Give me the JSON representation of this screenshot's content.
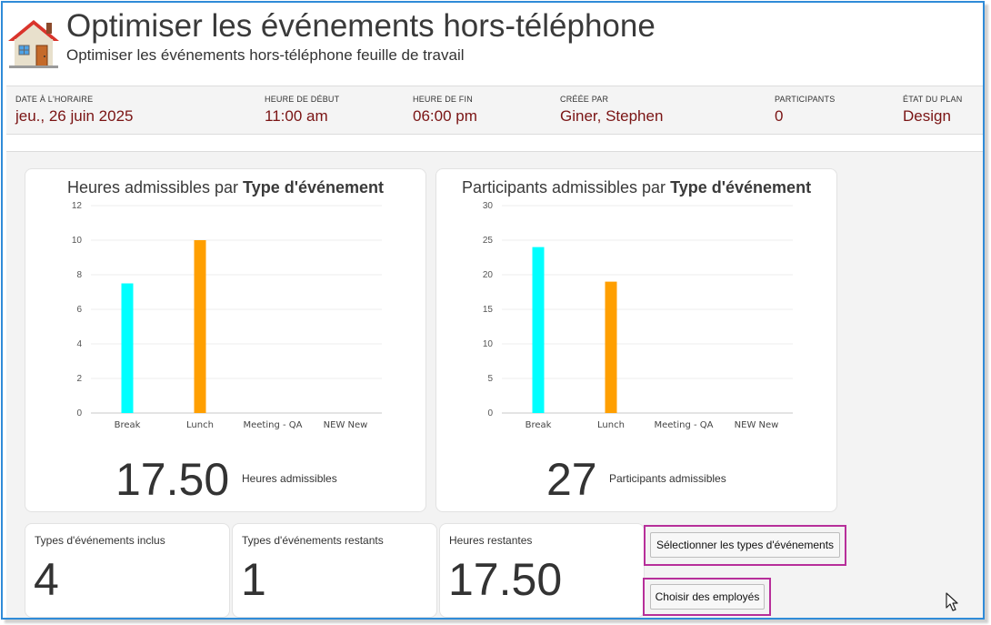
{
  "header": {
    "title": "Optimiser les événements hors-téléphone",
    "subtitle": "Optimiser les événements hors-téléphone feuille de travail",
    "icon": "house-icon"
  },
  "info": [
    {
      "label": "DATE À L'HORAIRE",
      "value": "jeu., 26 juin 2025"
    },
    {
      "label": "HEURE DE DÉBUT",
      "value": "11:00 am"
    },
    {
      "label": "HEURE DE FIN",
      "value": "06:00 pm"
    },
    {
      "label": "CRÉÉE PAR",
      "value": "Giner, Stephen"
    },
    {
      "label": "PARTICIPANTS",
      "value": "0"
    },
    {
      "label": "ÉTAT DU PLAN",
      "value": "Design"
    }
  ],
  "cards": {
    "hours": {
      "title_prefix": "Heures admissibles par",
      "title_bold": "Type d'événement",
      "total": "17.50",
      "total_label": "Heures admissibles"
    },
    "participants": {
      "title_prefix": "Participants admissibles par",
      "title_bold": "Type d'événement",
      "total": "27",
      "total_label": "Participants admissibles"
    }
  },
  "chart_data": [
    {
      "type": "bar",
      "title": "Heures admissibles par Type d'événement",
      "categories": [
        "Break",
        "Lunch",
        "Meeting - QA",
        "NEW New"
      ],
      "values": [
        7.5,
        10,
        0,
        0
      ],
      "colors": [
        "#00ffff",
        "#ff9f00",
        "#4a6fd8",
        "#2ecc40"
      ],
      "yticks": [
        0,
        2,
        4,
        6,
        8,
        10,
        12
      ],
      "ylim": [
        0,
        12
      ],
      "grid": true
    },
    {
      "type": "bar",
      "title": "Participants admissibles par Type d'événement",
      "categories": [
        "Break",
        "Lunch",
        "Meeting - QA",
        "NEW New"
      ],
      "values": [
        24,
        19,
        0,
        0
      ],
      "colors": [
        "#00ffff",
        "#ff9f00",
        "#4a6fd8",
        "#2ecc40"
      ],
      "yticks": [
        0,
        5,
        10,
        15,
        20,
        25,
        30
      ],
      "ylim": [
        0,
        30
      ],
      "grid": true
    }
  ],
  "stats": [
    {
      "label": "Types d'événements inclus",
      "value": "4"
    },
    {
      "label": "Types d'événements restants",
      "value": "1"
    },
    {
      "label": "Heures restantes",
      "value": "17.50"
    }
  ],
  "buttons": {
    "select_types": "Sélectionner les types d'événements",
    "choose_employees": "Choisir des employés"
  },
  "colors": {
    "accent_value": "#7a1414",
    "highlight_border": "#b72f9a",
    "frame_border": "#2f8bd8"
  }
}
